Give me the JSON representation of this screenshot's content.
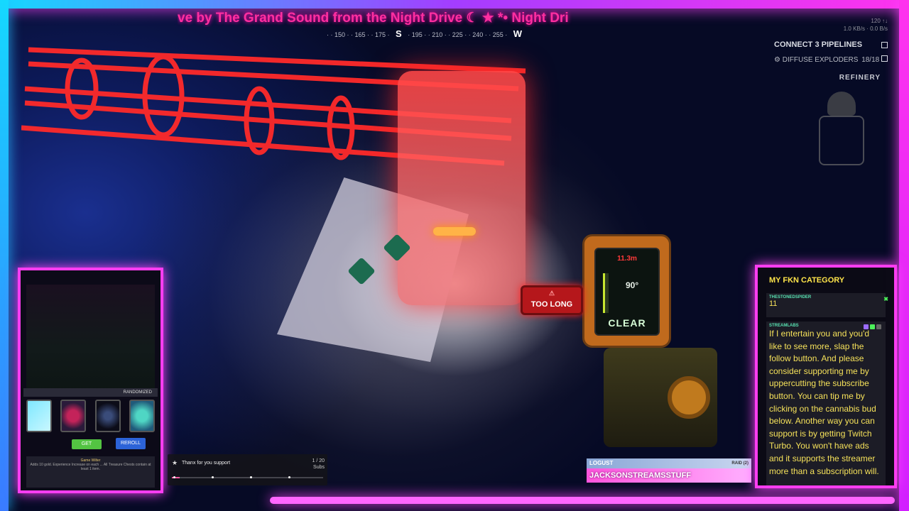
{
  "overlay": {
    "ticker_text": "ve by The Grand Sound from the Night Drive ☾ ★ *• Night Dri",
    "compass_heading": "S",
    "compass_heading_2": "W",
    "stats_line_1": "120 ↑↓",
    "stats_line_2": "1.0 KB/s · 0.0 B/s"
  },
  "hud": {
    "objective_title": "CONNECT 3 PIPELINES",
    "objective_sub_label": "DIFFUSE EXPLODERS",
    "objective_sub_count": "18/18",
    "location_label": "REFINERY",
    "device_warning": "TOO LONG",
    "device_degrees": "90°",
    "device_status": "CLEAR",
    "device_top_reading": "11.3m"
  },
  "webcam_panel": {
    "card_header": "RANDOMIZED",
    "get_button": "GET",
    "reroll_button": "REROLL",
    "reroll_cost": "1 left",
    "desc_title": "Game Wilter",
    "desc_body": "Adds 10 gold. Experience Increase on each ... All Treasure Chests contain at least 1 item."
  },
  "subs_widget": {
    "message": "Thanx for you support",
    "count": "1 / 20",
    "unit": "Subs",
    "progress": 0.05
  },
  "raid_widget": {
    "header": "LOGUST",
    "header_right": "RAID (2)",
    "name": "JACKSONSTREAMSSTUFF"
  },
  "chat": {
    "title": "MY FKN CATEGORY",
    "messages": [
      {
        "user": "THESTONEDSPIDER",
        "text": "11"
      },
      {
        "user": "STREAMLABS",
        "text": "If I entertain you and you'd like to see more, slap the follow button. And please consider supporting me by uppercutting the subscribe button. You can tip me by clicking on the cannabis bud below. Another way you can support is by getting Twitch Turbo. You won't have ads and it supports the streamer more than a subscription will."
      }
    ]
  },
  "colors": {
    "neon_pink": "#ff3df2",
    "neon_cyan": "#15d8ff",
    "chat_text": "#f5e15a",
    "ticker": "#ff2fa0",
    "hologram_red": "#ff2a2a"
  }
}
